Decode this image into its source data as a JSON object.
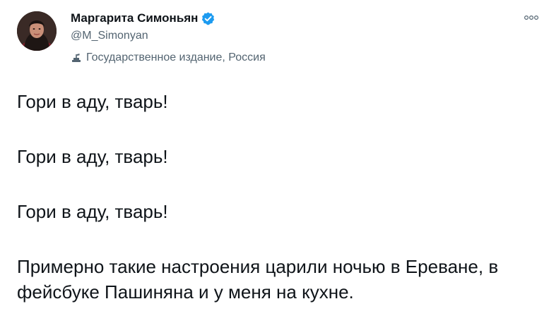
{
  "author": {
    "display_name": "Маргарита Симоньян",
    "handle": "@M_Simonyan",
    "label": "Государственное издание, Россия",
    "verified_color": "#1d9bf0"
  },
  "tweet": {
    "paragraphs": [
      "Гори в аду, тварь!",
      "Гори в аду, тварь!",
      "Гори в аду, тварь!",
      "Примерно такие настроения царили ночью в Ереване, в фейсбуке Пашиняна и у меня на кухне."
    ]
  },
  "icons": {
    "verified": "verified-badge-icon",
    "label": "government-podium-icon",
    "more": "more-dots-icon"
  }
}
